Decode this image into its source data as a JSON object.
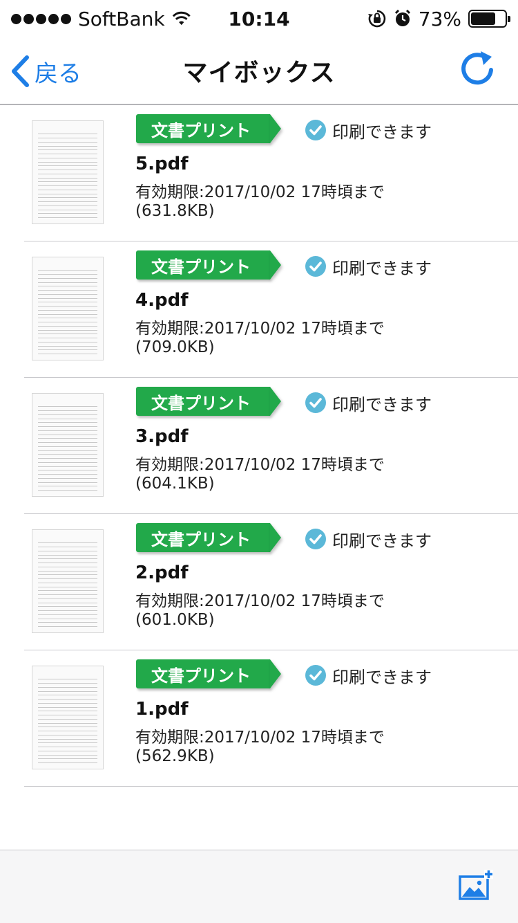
{
  "status_bar": {
    "carrier": "SoftBank",
    "time": "10:14",
    "battery_percent": "73%",
    "battery_level": 0.73,
    "icons": [
      "signal-dots-icon",
      "wifi-icon",
      "rotation-lock-icon",
      "alarm-icon",
      "battery-icon"
    ]
  },
  "nav": {
    "back_label": "戻る",
    "title": "マイボックス",
    "refresh_icon": "refresh-icon"
  },
  "colors": {
    "accent": "#1e7ee6",
    "badge_green": "#22a94a",
    "check_blue": "#5bb8d8"
  },
  "files": [
    {
      "badge": "文書プリント",
      "status": "印刷できます",
      "name": "5.pdf",
      "expiry": "有効期限:2017/10/02 17時頃まで",
      "size": "(631.8KB)"
    },
    {
      "badge": "文書プリント",
      "status": "印刷できます",
      "name": "4.pdf",
      "expiry": "有効期限:2017/10/02 17時頃まで",
      "size": "(709.0KB)"
    },
    {
      "badge": "文書プリント",
      "status": "印刷できます",
      "name": "3.pdf",
      "expiry": "有効期限:2017/10/02 17時頃まで",
      "size": "(604.1KB)"
    },
    {
      "badge": "文書プリント",
      "status": "印刷できます",
      "name": "2.pdf",
      "expiry": "有効期限:2017/10/02 17時頃まで",
      "size": "(601.0KB)"
    },
    {
      "badge": "文書プリント",
      "status": "印刷できます",
      "name": "1.pdf",
      "expiry": "有効期限:2017/10/02 17時頃まで",
      "size": "(562.9KB)"
    }
  ],
  "toolbar": {
    "add_image_icon": "add-image-icon"
  }
}
